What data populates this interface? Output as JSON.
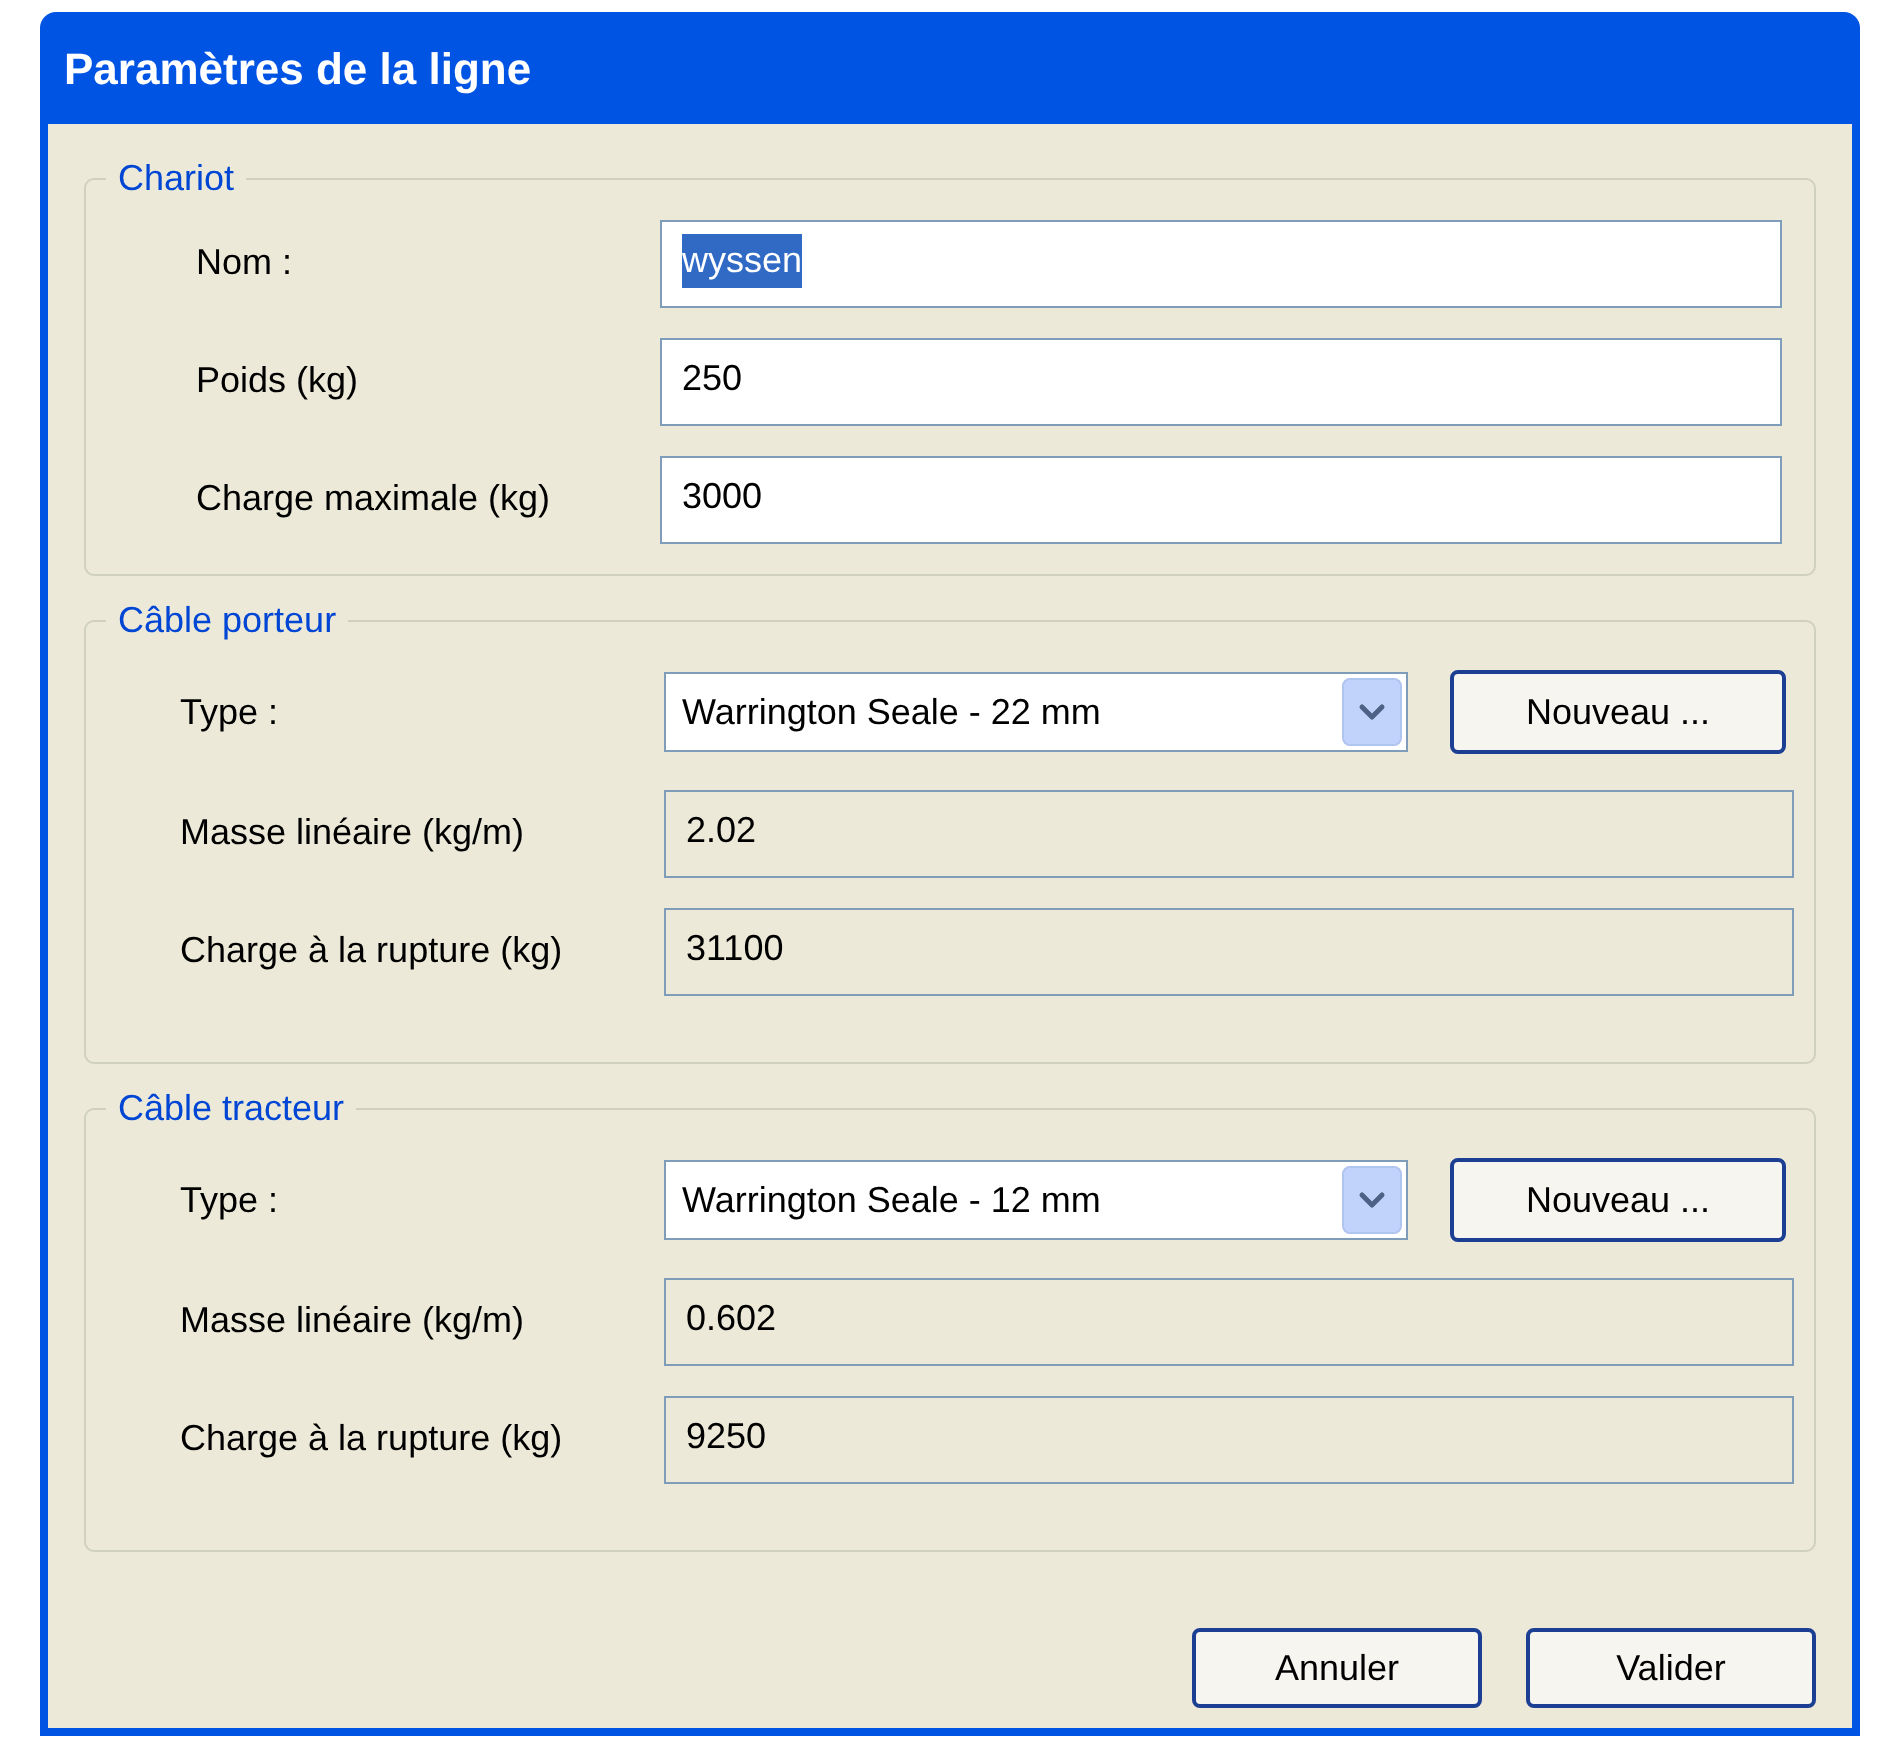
{
  "window": {
    "title": "Paramètres de la ligne"
  },
  "groups": [
    {
      "legend": "Chariot",
      "rows": [
        {
          "kind": "input",
          "label": "Nom :",
          "value": "wyssen",
          "selected": true
        },
        {
          "kind": "input",
          "label": "Poids (kg)",
          "value": "250",
          "selected": false
        },
        {
          "kind": "input",
          "label": "Charge maximale (kg)",
          "value": "3000",
          "selected": false
        }
      ]
    },
    {
      "legend": "Câble porteur",
      "rows": [
        {
          "kind": "select",
          "label": "Type :",
          "value": "Warrington Seale - 22 mm",
          "button": "Nouveau ..."
        },
        {
          "kind": "readonly",
          "label": "Masse linéaire (kg/m)",
          "value": "2.02"
        },
        {
          "kind": "readonly",
          "label": "Charge à la rupture (kg)",
          "value": "31100"
        }
      ]
    },
    {
      "legend": "Câble tracteur",
      "rows": [
        {
          "kind": "select",
          "label": "Type :",
          "value": "Warrington Seale - 12 mm",
          "button": "Nouveau ..."
        },
        {
          "kind": "readonly",
          "label": "Masse linéaire (kg/m)",
          "value": "0.602"
        },
        {
          "kind": "readonly",
          "label": "Charge à la rupture (kg)",
          "value": "9250"
        }
      ]
    }
  ],
  "buttons": [
    "Annuler",
    "Valider"
  ]
}
